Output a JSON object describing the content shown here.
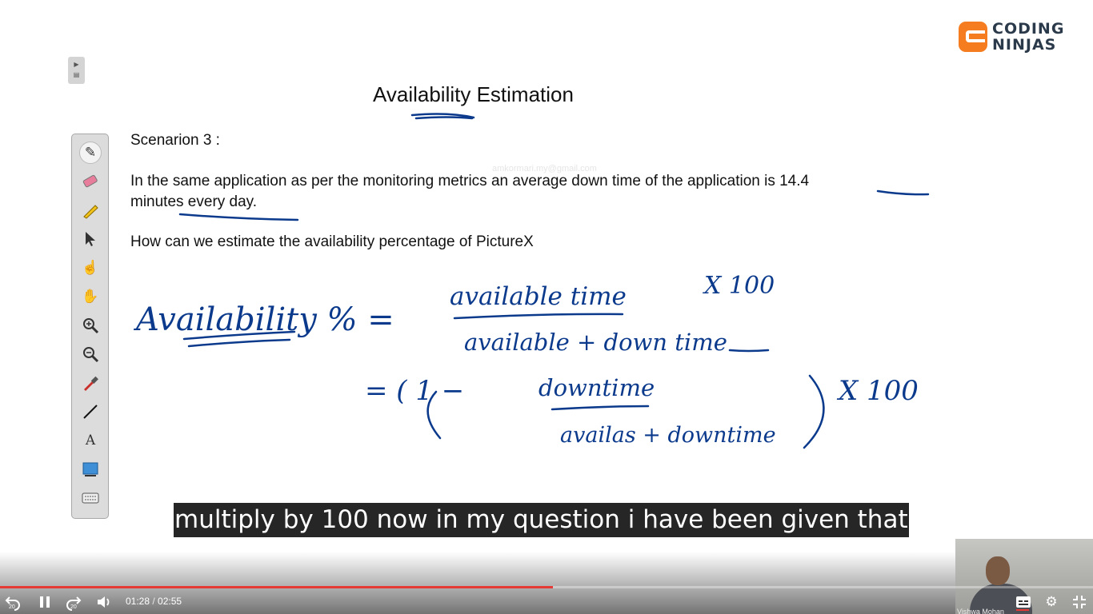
{
  "brand": {
    "line1": "CODING",
    "line2": "NINJAS",
    "accent": "#f57c1f"
  },
  "slide": {
    "title": "Availability Estimation",
    "scenario": "Scenarion 3 :",
    "line1": "In the same application as per the monitoring metrics an average down time of the application is 14.4",
    "line2": "minutes every day.",
    "question": "How can we estimate the availability percentage of PictureX",
    "watermark": "amkormari.my@gmail.com"
  },
  "handwriting": {
    "lhs": "Availability % =",
    "numerator": "available time",
    "times100": "X 100",
    "denominator": "available + down time",
    "eq2_prefix": "= ( 1 −",
    "eq2_num": "downtime",
    "eq2_den": "availas + downtime",
    "eq2_times100": "X 100",
    "ink_color": "#0b3a8c"
  },
  "toolbar": {
    "tools": [
      "pen-icon",
      "eraser-icon",
      "highlighter-icon",
      "pointer-icon",
      "laser-hand-icon",
      "hand-icon",
      "zoom-in-icon",
      "zoom-out-icon",
      "color-picker-icon",
      "line-icon",
      "text-icon",
      "screen-capture-icon",
      "keyboard-icon"
    ],
    "text_tool_label": "A"
  },
  "caption": {
    "text": "multiply by 100 now in my question i have been given that"
  },
  "player": {
    "current_time": "01:28",
    "duration": "02:55",
    "progress": 0.506,
    "rewind_label": "20",
    "forward_label": "20",
    "accent": "#e53935"
  },
  "webcam": {
    "label": "Vishwa Mohan"
  }
}
